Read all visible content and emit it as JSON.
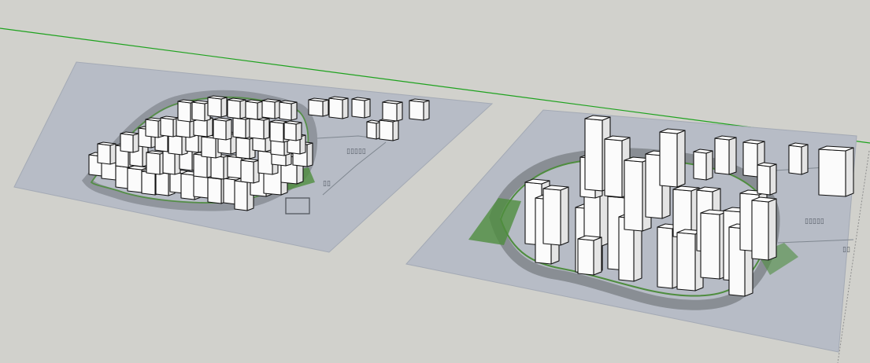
{
  "app": {
    "title": ""
  },
  "scene": {
    "background": "#d1d1cc",
    "horizon_color": "#1ea21e",
    "site_color": "#b7bcc6",
    "site_edge": "#a4aab5",
    "road_color": "#8d9297",
    "green_color": "#4f8d3f",
    "building_top": "#ffffff",
    "building_front": "#fbfbfb",
    "building_side": "#e4e4e4",
    "building_stroke": "#111111"
  }
}
